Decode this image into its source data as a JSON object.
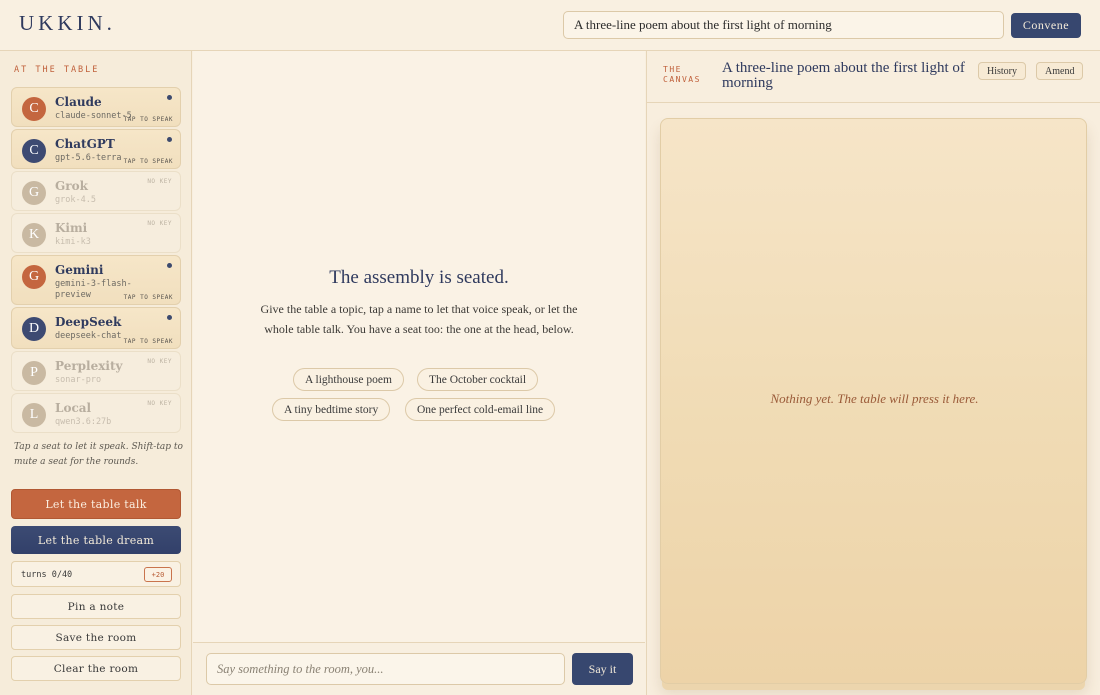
{
  "app": {
    "logo": "UKKIN."
  },
  "header": {
    "topic_value": "A three-line poem about the first light of morning",
    "convene_label": "Convene"
  },
  "sidebar": {
    "section_label": "AT THE TABLE",
    "seats": [
      {
        "initial": "C",
        "name": "Claude",
        "model": "claude-sonnet-5",
        "status": "TAP TO SPEAK",
        "active": true,
        "color": "#c4663f"
      },
      {
        "initial": "C",
        "name": "ChatGPT",
        "model": "gpt-5.6-terra",
        "status": "TAP TO SPEAK",
        "active": true,
        "color": "#3d4a72"
      },
      {
        "initial": "G",
        "name": "Grok",
        "model": "grok-4.5",
        "status": "NO KEY",
        "active": false,
        "color": "#c9b9a2"
      },
      {
        "initial": "K",
        "name": "Kimi",
        "model": "kimi-k3",
        "status": "NO KEY",
        "active": false,
        "color": "#c9b9a2"
      },
      {
        "initial": "G",
        "name": "Gemini",
        "model": "gemini-3-flash-preview",
        "status": "TAP TO SPEAK",
        "active": true,
        "color": "#c4663f"
      },
      {
        "initial": "D",
        "name": "DeepSeek",
        "model": "deepseek-chat",
        "status": "TAP TO SPEAK",
        "active": true,
        "color": "#3d4a72"
      },
      {
        "initial": "P",
        "name": "Perplexity",
        "model": "sonar-pro",
        "status": "NO KEY",
        "active": false,
        "color": "#c9b9a2"
      },
      {
        "initial": "L",
        "name": "Local",
        "model": "qwen3.6:27b",
        "status": "NO KEY",
        "active": false,
        "color": "#c9b9a2"
      }
    ],
    "tip": "Tap a seat to let it speak. Shift-tap to mute a seat for the rounds.",
    "talk_label": "Let the table talk",
    "dream_label": "Let the table dream",
    "turns_text": "turns 0/40",
    "plus_label": "+20",
    "pin_label": "Pin a note",
    "save_label": "Save the room",
    "clear_label": "Clear the room"
  },
  "main": {
    "empty_title": "The assembly is seated.",
    "empty_text": "Give the table a topic, tap a name to let that voice speak, or let the whole table talk. You have a seat too: the one at the head, below.",
    "suggestions": [
      "A lighthouse poem",
      "The October cocktail",
      "A tiny bedtime story",
      "One perfect cold-email line"
    ],
    "composer_placeholder": "Say something to the room, you...",
    "say_label": "Say it"
  },
  "canvas": {
    "label": "THE CANVAS",
    "title": "A three-line poem about the first light of morning",
    "history_label": "History",
    "amend_label": "Amend",
    "empty_note": "Nothing yet. The table will press it here."
  }
}
